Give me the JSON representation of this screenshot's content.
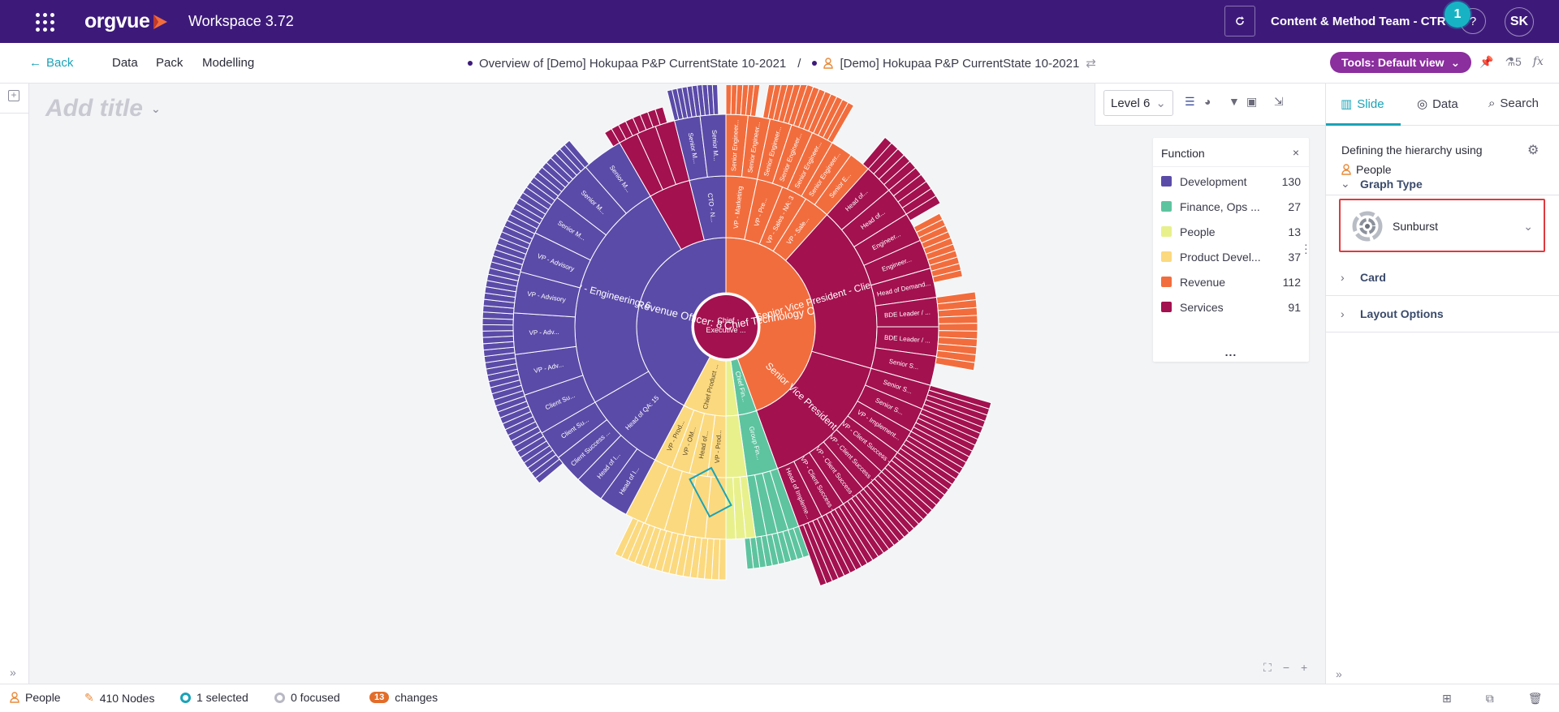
{
  "topbar": {
    "brand": "orgvue",
    "workspace": "Workspace 3.72",
    "team": "Content & Method Team - CTR",
    "help": "?",
    "step_badge": "1",
    "avatar": "SK",
    "brand_color": "#3d1a7a"
  },
  "navbar": {
    "back": "Back",
    "data": "Data",
    "pack": "Pack",
    "modelling": "Modelling",
    "crumb_overview": "Overview of [Demo] Hokupaa P&P CurrentState 10-2021",
    "crumb_sep": "/",
    "crumb_dataset": "[Demo] Hokupaa P&P CurrentState 10-2021",
    "tools": "Tools: Default view",
    "flask_count": "5",
    "fx": "fx"
  },
  "canvas": {
    "title_placeholder": "Add title",
    "level": "Level 6",
    "center_label_1": "Chief",
    "center_label_2": "Executive ..."
  },
  "legend": {
    "title": "Function",
    "items": [
      {
        "label": "Development",
        "count": "130",
        "color": "#5b4ba8"
      },
      {
        "label": "Finance, Ops ...",
        "count": "27",
        "color": "#5ec4a0"
      },
      {
        "label": "People",
        "count": "13",
        "color": "#e8f08c"
      },
      {
        "label": "Product Devel...",
        "count": "37",
        "color": "#fbd97f"
      },
      {
        "label": "Revenue",
        "count": "112",
        "color": "#f26d3d"
      },
      {
        "label": "Services",
        "count": "91",
        "color": "#a3114f"
      }
    ],
    "more": "..."
  },
  "sunburst_labels": {
    "ring1": [
      {
        "text": "Chief Technology Officer: 7",
        "fn": "Development"
      },
      {
        "text": "Chief Revenue Officer: 8",
        "fn": "Revenue"
      },
      {
        "text": "Chief Product ...",
        "fn": "Product Devel..."
      },
      {
        "text": "Chief Fin...",
        "fn": "Finance, Ops ..."
      }
    ],
    "ring2": [
      {
        "text": "VP - Engineering: 6"
      },
      {
        "text": "Head of QA: 15"
      },
      {
        "text": "CTO - N..."
      },
      {
        "text": "Senior Vice President - Client Success: 6"
      },
      {
        "text": "Senior Vice President - Advi..."
      },
      {
        "text": "VP - Marketing"
      },
      {
        "text": "VP - Pre..."
      },
      {
        "text": "VP - Sales - NA: 3"
      },
      {
        "text": "VP - Sale..."
      },
      {
        "text": "Head of..."
      },
      {
        "text": "VP - Prod..."
      },
      {
        "text": "VP - OM..."
      },
      {
        "text": "Head of..."
      },
      {
        "text": "VP - Prod..."
      },
      {
        "text": "Group Fin..."
      }
    ],
    "ring3": [
      {
        "text": "Senior Engineer..."
      },
      {
        "text": "Senior Engineer..."
      },
      {
        "text": "Senior Engineer..."
      },
      {
        "text": "Senior Engineer..."
      },
      {
        "text": "Senior Engineer..."
      },
      {
        "text": "Senior Engineer..."
      },
      {
        "text": "Senior E..."
      },
      {
        "text": "Head of..."
      },
      {
        "text": "Head of..."
      },
      {
        "text": "Engineer..."
      },
      {
        "text": "Engineer..."
      },
      {
        "text": "Head of Demand..."
      },
      {
        "text": "BDE Leader / ..."
      },
      {
        "text": "BDE Leader / ..."
      },
      {
        "text": "Senior S..."
      },
      {
        "text": "Senior S..."
      },
      {
        "text": "Senior S..."
      },
      {
        "text": "VP - Implement..."
      },
      {
        "text": "VP - Client Success -"
      },
      {
        "text": "VP - Client Success -"
      },
      {
        "text": "VP - Client Success -"
      },
      {
        "text": "VP - Client Success -"
      },
      {
        "text": "Head of Impleme..."
      },
      {
        "text": "Head of I..."
      },
      {
        "text": "Head of I..."
      },
      {
        "text": "Client Success ..."
      },
      {
        "text": "Client Su..."
      },
      {
        "text": "Client Su..."
      },
      {
        "text": "VP - Adv..."
      },
      {
        "text": "VP - Adv..."
      },
      {
        "text": "VP - Advisory"
      },
      {
        "text": "VP - Advisory"
      },
      {
        "text": "Senior M..."
      },
      {
        "text": "Senior M..."
      },
      {
        "text": "Senior M..."
      },
      {
        "text": "Senior M..."
      },
      {
        "text": "Senior M..."
      },
      {
        "text": "Senior M..."
      },
      {
        "text": "Head of..."
      }
    ]
  },
  "rpanel": {
    "tab_slide": "Slide",
    "tab_data": "Data",
    "tab_search": "Search",
    "hierarchy_label": "Defining the hierarchy using",
    "hierarchy_value": "People",
    "graph_type": "Graph Type",
    "graph_type_value": "Sunburst",
    "card": "Card",
    "layout_options": "Layout Options",
    "accent": "#1aa3b8"
  },
  "statusbar": {
    "people": "People",
    "nodes": "410 Nodes",
    "selected": "1 selected",
    "focused": "0 focused",
    "changes_count": "13",
    "changes": "changes"
  }
}
